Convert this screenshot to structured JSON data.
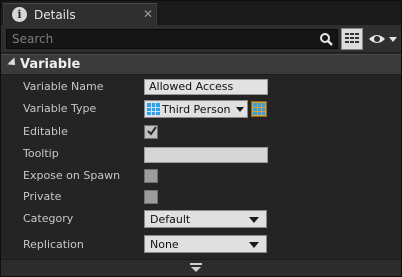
{
  "tab": {
    "title": "Details",
    "icon": "info-icon",
    "close_glyph": "✕"
  },
  "toolbar": {
    "search_placeholder": "Search",
    "search_value": "",
    "search_icon": "search-icon",
    "grid_icon": "property-matrix-icon",
    "view_icon": "eye-icon"
  },
  "section": {
    "title": "Variable",
    "expanded": true
  },
  "properties": {
    "variable_name": {
      "label": "Variable Name",
      "value": "Allowed Access"
    },
    "variable_type": {
      "label": "Variable Type",
      "value": "Third Person C",
      "type_color": "#2f9fe8",
      "container_color": "#d8a23a"
    },
    "editable": {
      "label": "Editable",
      "checked": true
    },
    "tooltip": {
      "label": "Tooltip",
      "value": ""
    },
    "expose_on_spawn": {
      "label": "Expose on Spawn",
      "checked": false
    },
    "private": {
      "label": "Private",
      "checked": false
    },
    "category": {
      "label": "Category",
      "value": "Default"
    },
    "replication": {
      "label": "Replication",
      "value": "None"
    }
  },
  "footer": {
    "icon": "expand-down-icon"
  },
  "colors": {
    "panel": "#242424",
    "header": "#3a3a3a",
    "field": "#e0e0e0",
    "accent": "#2f9fe8"
  }
}
